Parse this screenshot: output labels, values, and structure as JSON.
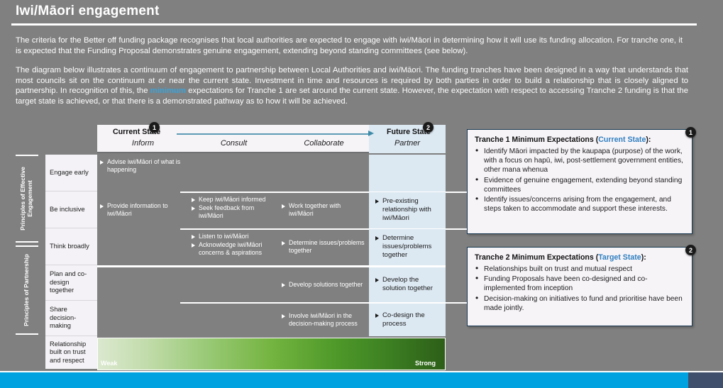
{
  "slide": {
    "title": "Iwi/Māori engagement",
    "paragraphs": [
      "The criteria for the Better off funding package recognises that local authorities are expected to engage with iwi/Māori in determining how it will use its funding allocation. For tranche one, it is expected that the Funding Proposal demonstrates genuine engagement, extending beyond standing committees (see below).",
      {
        "pre": "The diagram below illustrates a continuum of engagement to partnership between Local Authorities and iwi/Māori. The funding tranches have been designed in a way that understands that most councils sit on the continuum at or near the current state. Investment in time and resources is required by both parties in order to build a relationship that is closely aligned to partnership. In recognition of this, the ",
        "highlight": "minimum",
        "post": " expectations for Tranche 1 are set around the current state. However, the expectation with respect to accessing Tranche 2 funding is that the target state is achieved, or that there is a demonstrated pathway as to how it will be achieved."
      }
    ]
  },
  "diagram": {
    "state_labels": {
      "current": "Current State",
      "future": "Future State"
    },
    "badges": {
      "one": "1",
      "two": "2"
    },
    "columns": [
      "Inform",
      "Consult",
      "Collaborate",
      "Partner"
    ],
    "row_groups": [
      {
        "label": "Principles of Effective\nEngagement"
      },
      {
        "label": "Principles of Partnership"
      }
    ],
    "group1_rail_line1": "Principles of Effective",
    "group1_rail_line2": "Engagement",
    "group2_rail": "Principles of Partnership",
    "rows": [
      {
        "descriptor": "Engage early",
        "inform": [
          "Advise iwi/Māori of what is happening"
        ],
        "consult": [],
        "collaborate": [],
        "partner": []
      },
      {
        "descriptor": "Be inclusive",
        "inform": [
          "Provide information to iwi/Māori"
        ],
        "consult": [
          "Keep iwi/Māori informed",
          "Seek feedback from iwi/Māori"
        ],
        "collaborate": [
          "Work together with iwi/Māori"
        ],
        "partner": [
          "Pre-existing relationship with iwi/Māori"
        ]
      },
      {
        "descriptor": "Think broadly",
        "inform": [],
        "consult": [
          "Listen to iwi/Māori",
          "Acknowledge iwi/Māori concerns & aspirations"
        ],
        "collaborate": [
          "Determine issues/problems together"
        ],
        "partner": [
          "Determine issues/problems together"
        ]
      },
      {
        "descriptor": "Plan and co-design together",
        "inform": [],
        "consult": [],
        "collaborate": [
          "Develop solutions together"
        ],
        "partner": [
          "Develop the solution together"
        ]
      },
      {
        "descriptor": "Share decision-making",
        "inform": [],
        "consult": [],
        "collaborate": [
          "Involve iwi/Māori in the decision-making process"
        ],
        "partner": [
          "Co-design the process"
        ]
      },
      {
        "descriptor": "Relationship built on trust and respect",
        "inform": [],
        "consult": [],
        "collaborate": [],
        "partner": []
      }
    ],
    "gradient": {
      "weak": "Weak",
      "strong": "Strong",
      "colors": [
        "#dbe8cf",
        "#74b440",
        "#2d5e18"
      ]
    }
  },
  "info_boxes": [
    {
      "title_main": "Tranche 1 Minimum Expectations (",
      "title_state": "Current State",
      "title_end": "):",
      "badge": "1",
      "items": [
        "Identify Māori impacted by the kaupapa (purpose) of the work, with a focus on hapū, iwi, post-settlement government entities, other mana whenua",
        "Evidence of genuine engagement, extending beyond standing committees",
        "Identify issues/concerns arising from the engagement, and steps taken to accommodate and support these interests."
      ]
    },
    {
      "title_main": "Tranche 2 Minimum Expectations (",
      "title_state": "Target State",
      "title_end": "):",
      "badge": "2",
      "items": [
        "Relationships built on trust and mutual respect",
        "Funding Proposals have been co-designed and co-implemented from inception",
        "Decision-making on initiatives to fund and prioritise have been made jointly."
      ]
    }
  ],
  "theme": {
    "background": "#808080",
    "accent_blue": "#00a3e0",
    "accent_navy": "#404f6b",
    "link_blue": "#3aa3d9",
    "partner_bg": "#dce8f2",
    "panel_bg": "#f7f4f8"
  }
}
